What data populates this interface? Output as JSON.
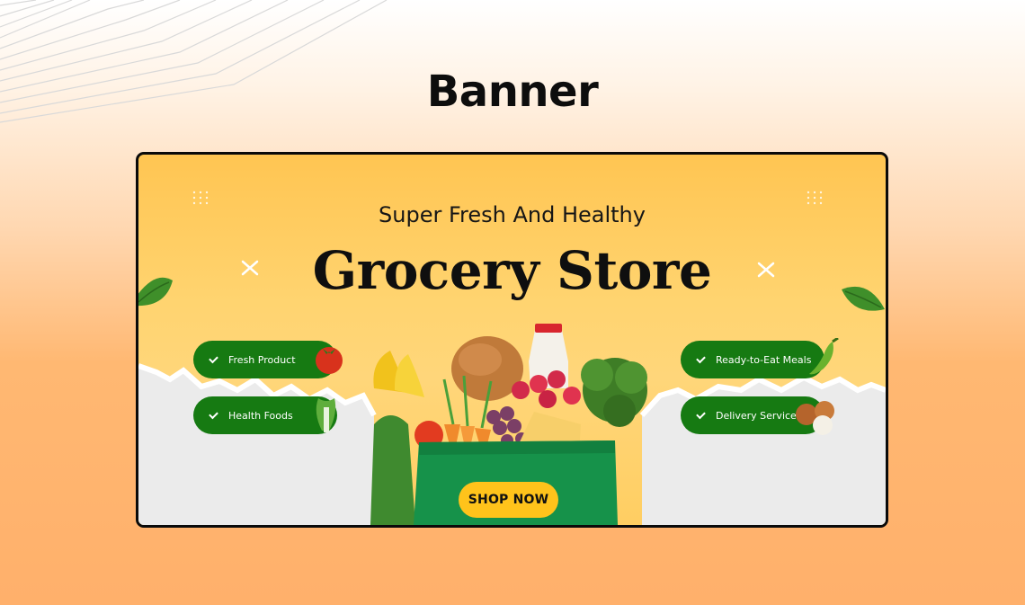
{
  "page": {
    "title": "Banner"
  },
  "banner": {
    "subtitle": "Super Fresh And Healthy",
    "title": "Grocery Store",
    "features_left": [
      {
        "label": "Fresh Product",
        "icon": "tomato-icon"
      },
      {
        "label": "Health Foods",
        "icon": "bok-choy-icon"
      }
    ],
    "features_right": [
      {
        "label": "Ready-to-Eat Meals",
        "icon": "pepper-icon"
      },
      {
        "label": "Delivery Service",
        "icon": "onion-icon"
      }
    ],
    "cta_label": "SHOP NOW"
  },
  "colors": {
    "pill_green": "#167a12",
    "cta_yellow": "#ffc31b",
    "banner_yellow": "#ffc552",
    "bag_green": "#16924a"
  }
}
